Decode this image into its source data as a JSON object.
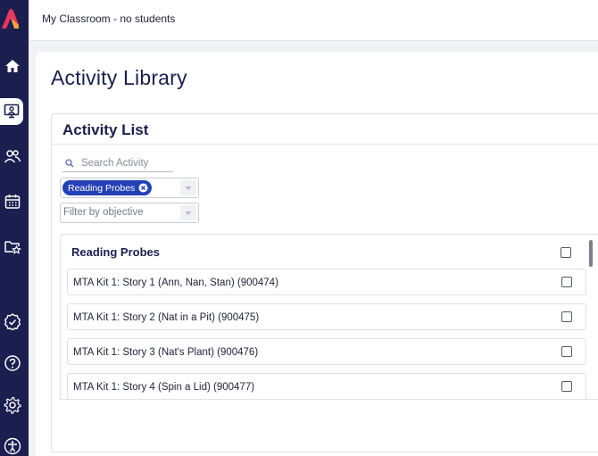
{
  "app": {
    "classroom_label": "My Classroom - no students"
  },
  "sidebar": {
    "items": [
      {
        "icon": "home-icon"
      },
      {
        "icon": "teacher-board-icon",
        "active": true
      },
      {
        "icon": "users-icon"
      },
      {
        "icon": "calendar-icon"
      },
      {
        "icon": "folder-star-icon"
      },
      {
        "icon": "badge-check-icon"
      },
      {
        "icon": "help-icon"
      },
      {
        "icon": "gear-icon"
      },
      {
        "icon": "accessibility-icon"
      }
    ],
    "accent_color": "#1b1f4f"
  },
  "page": {
    "title": "Activity Library"
  },
  "activity_list": {
    "title": "Activity List",
    "search": {
      "placeholder": "Search Activity",
      "value": ""
    },
    "category_filter": {
      "selected_chip": "Reading Probes",
      "chip_color": "#2440b6"
    },
    "objective_filter": {
      "placeholder": "Filter by objective"
    },
    "group": {
      "title": "Reading Probes",
      "checked": false,
      "items": [
        {
          "label": "MTA Kit 1: Story 1 (Ann, Nan, Stan) (900474)",
          "checked": false
        },
        {
          "label": "MTA Kit 1: Story 2 (Nat in a Pit) (900475)",
          "checked": false
        },
        {
          "label": "MTA Kit 1: Story 3 (Nat's Plant) (900476)",
          "checked": false
        },
        {
          "label": "MTA Kit 1: Story 4 (Spin a Lid) (900477)",
          "checked": false
        }
      ]
    }
  }
}
